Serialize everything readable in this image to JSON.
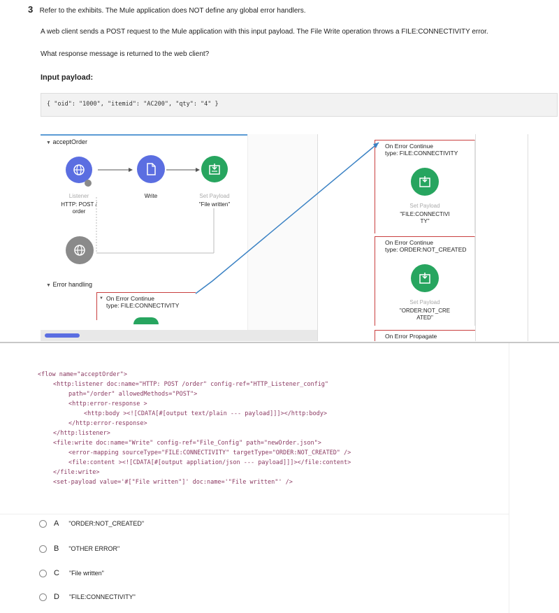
{
  "question": {
    "number": "3",
    "line1": "Refer to the exhibits. The Mule application does NOT define any global error handlers.",
    "line2": "A web client sends a POST request to the Mule application with this input payload. The File Write operation throws a FILE:CONNECTIVITY error.",
    "line3": "What response message is returned to the web client?",
    "input_label": "Input payload:",
    "payload": "{ \"oid\": \"1000\", \"itemid\": \"AC200\", \"qty\": \"4\" }"
  },
  "diagram": {
    "flow_name": "acceptOrder",
    "listener": {
      "name": "Listener",
      "detail_line1": "HTTP: POST /",
      "detail_line2": "order"
    },
    "write": {
      "name": "Write"
    },
    "set_payload": {
      "name": "Set Payload",
      "detail": "\"File written\""
    },
    "error_handling": "Error handling",
    "left_error": {
      "title": "On Error Continue",
      "type": "type: FILE:CONNECTIVITY"
    },
    "right_error1": {
      "title": "On Error Continue",
      "type": "type: FILE:CONNECTIVITY",
      "sp_name": "Set Payload",
      "sp_l1": "\"FILE:CONNECTIVI",
      "sp_l2": "TY\""
    },
    "right_error2": {
      "title": "On Error Continue",
      "type": "type: ORDER:NOT_CREATED",
      "sp_name": "Set Payload",
      "sp_l1": "\"ORDER:NOT_CRE",
      "sp_l2": "ATED\""
    },
    "right_error3": {
      "title": "On Error Propagate"
    },
    "colors": {
      "blue_node": "#5b6ee1",
      "green_node": "#27a55f",
      "grey_node": "#8a8a8a",
      "arrow": "#3b82c4",
      "error_line": "#c94040"
    }
  },
  "code": {
    "l1": "<flow name=\"acceptOrder\">",
    "l2": "<http:listener doc:name=\"HTTP: POST /order\" config-ref=\"HTTP_Listener_config\"",
    "l3": "path=\"/order\" allowedMethods=\"POST\">",
    "l4": "<http:error-response >",
    "l5": "<http:body ><![CDATA[#[output text/plain --- payload]]]></http:body>",
    "l6": "</http:error-response>",
    "l7": "</http:listener>",
    "l8": "<file:write doc:name=\"Write\" config-ref=\"File_Config\" path=\"newOrder.json\">",
    "l9": "<error-mapping sourceType=\"FILE:CONNECTIVITY\" targetType=\"ORDER:NOT_CREATED\" />",
    "l10": "<file:content ><![CDATA[#[output appliation/json --- payload]]]></file:content>",
    "l11": "</file:write>",
    "l12": "<set-payload value='#[\"File written\"]' doc:name='\"File written\"' />"
  },
  "options": [
    {
      "letter": "A",
      "text": "\"ORDER:NOT_CREATED\""
    },
    {
      "letter": "B",
      "text": "\"OTHER ERROR\""
    },
    {
      "letter": "C",
      "text": "\"File written\""
    },
    {
      "letter": "D",
      "text": "\"FILE:CONNECTIVITY\""
    }
  ]
}
